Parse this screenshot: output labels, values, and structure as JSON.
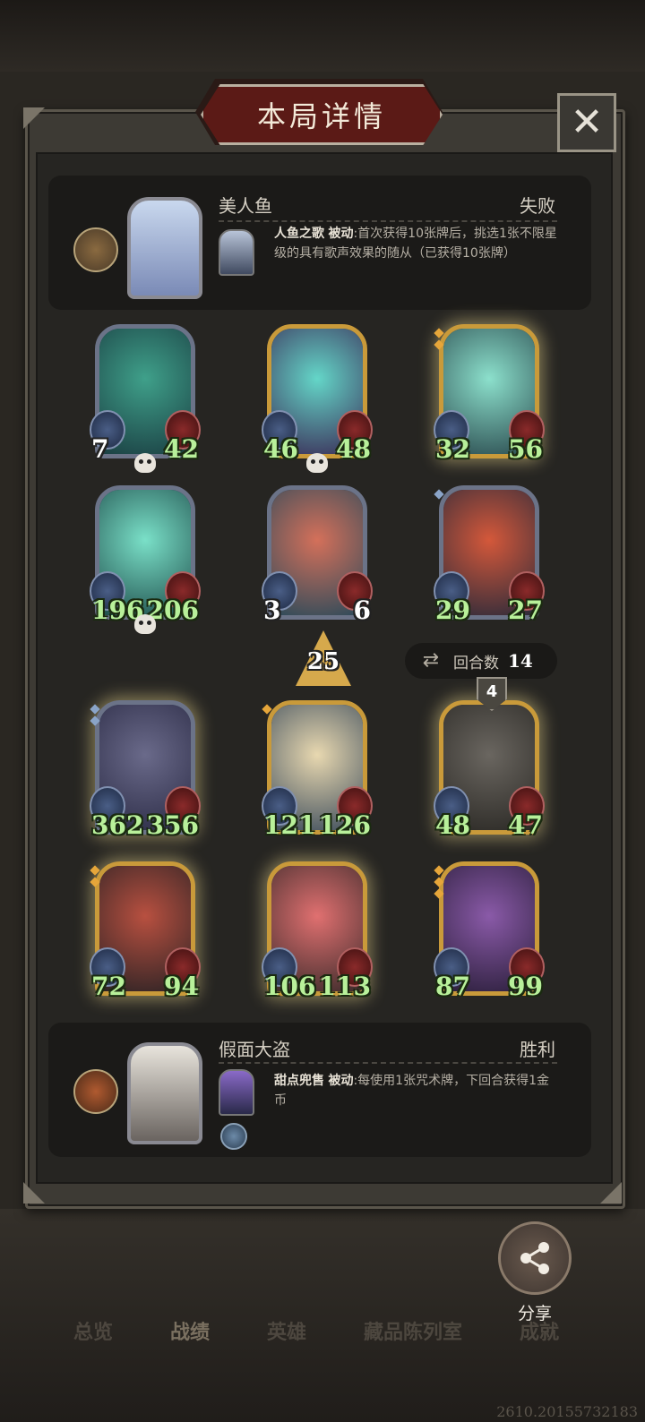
{
  "title": "本局详情",
  "close_icon": "close-icon",
  "top_player": {
    "name": "美人鱼",
    "result": "失败",
    "skill_name": "人鱼之歌",
    "skill_type": "被动",
    "skill_desc": ":首次获得10张牌后，挑选1张不限星级的具有歌声效果的随从（已获得10张牌）"
  },
  "top_board": [
    {
      "atk": "7",
      "hp": "42",
      "dead": true
    },
    {
      "atk": "46",
      "hp": "48",
      "dead": true
    },
    {
      "atk": "32",
      "hp": "56",
      "dead": false
    },
    {
      "atk": "196",
      "hp": "206",
      "dead": true
    },
    {
      "atk": "3",
      "hp": "6",
      "dead": false
    },
    {
      "atk": "29",
      "hp": "27",
      "dead": false
    }
  ],
  "damage": "25",
  "round": {
    "label": "回合数",
    "value": "14"
  },
  "bottom_board": [
    {
      "atk": "362",
      "hp": "356"
    },
    {
      "atk": "121",
      "hp": "126"
    },
    {
      "atk": "48",
      "hp": "47",
      "tier": "4"
    },
    {
      "atk": "72",
      "hp": "94"
    },
    {
      "atk": "106",
      "hp": "113"
    },
    {
      "atk": "87",
      "hp": "99"
    }
  ],
  "bottom_player": {
    "name": "假面大盗",
    "result": "胜利",
    "skill_name": "甜点兜售",
    "skill_type": "被动",
    "skill_desc": ":每使用1张咒术牌，下回合获得1金币"
  },
  "share_label": "分享",
  "tabs": [
    "总览",
    "战绩",
    "英雄",
    "藏品陈列室",
    "成就"
  ],
  "footer_code": "2610.20155732183"
}
